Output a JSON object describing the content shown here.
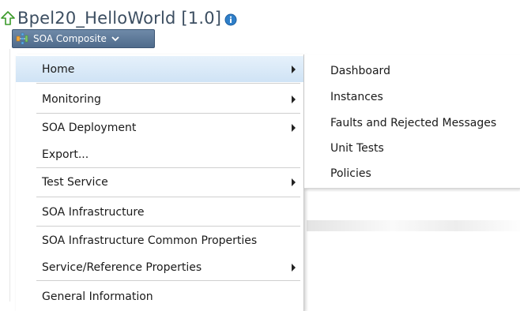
{
  "header": {
    "title": "Bpel20_HelloWorld [1.0]",
    "up_icon": "green-up-arrow-icon",
    "info_icon": "info-icon"
  },
  "composite_button": {
    "label": "SOA Composite",
    "icon": "composite-icon"
  },
  "menu": {
    "items": [
      {
        "label": "Home",
        "has_submenu": true,
        "highlighted": true
      },
      {
        "label": "Monitoring",
        "has_submenu": true
      },
      {
        "label": "SOA Deployment",
        "has_submenu": true
      },
      {
        "label": "Export...",
        "has_submenu": false
      },
      {
        "label": "Test Service",
        "has_submenu": true
      },
      {
        "label": "SOA Infrastructure",
        "has_submenu": false
      },
      {
        "label": "SOA Infrastructure Common Properties",
        "has_submenu": false
      },
      {
        "label": "Service/Reference Properties",
        "has_submenu": true
      },
      {
        "label": "General Information",
        "has_submenu": false
      }
    ]
  },
  "submenu": {
    "items": [
      {
        "label": "Dashboard"
      },
      {
        "label": "Instances"
      },
      {
        "label": "Faults and Rejected Messages"
      },
      {
        "label": "Unit Tests"
      },
      {
        "label": "Policies"
      }
    ]
  },
  "colors": {
    "title": "#3c4e61",
    "button_bg": "#5a7696",
    "highlight": "#d8e9f8"
  }
}
